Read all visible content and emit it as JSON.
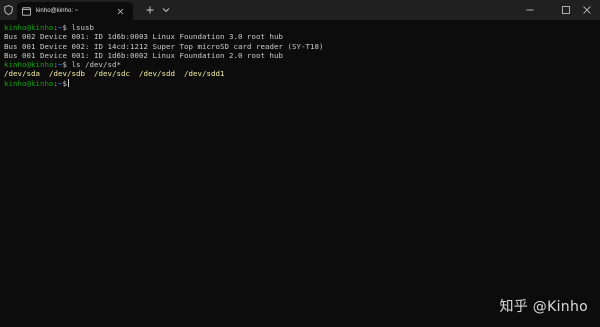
{
  "window": {
    "tab_title": "kinho@kinho: ~",
    "new_tab_icon": "plus-icon",
    "dropdown_icon": "chevron-down-icon"
  },
  "terminal": {
    "prompt": {
      "user_host": "kinho@kinho",
      "separator": ":",
      "path": "~",
      "symbol": "$"
    },
    "colors": {
      "prompt_user": "#13a10e",
      "prompt_path": "#3b78ff",
      "device": "#f9f1a5",
      "text": "#cccccc"
    },
    "command1": " lsusb",
    "output1": [
      "Bus 002 Device 001: ID 1d6b:0003 Linux Foundation 3.0 root hub",
      "Bus 001 Device 002: ID 14cd:1212 Super Top microSD card reader (SY-T18)",
      "Bus 001 Device 001: ID 1d6b:0002 Linux Foundation 2.0 root hub"
    ],
    "command2": " ls /dev/sd*",
    "devices": [
      "/dev/sda",
      "/dev/sdb",
      "/dev/sdc",
      "/dev/sdd",
      "/dev/sdd1"
    ]
  },
  "watermark": "知乎 @Kinho"
}
